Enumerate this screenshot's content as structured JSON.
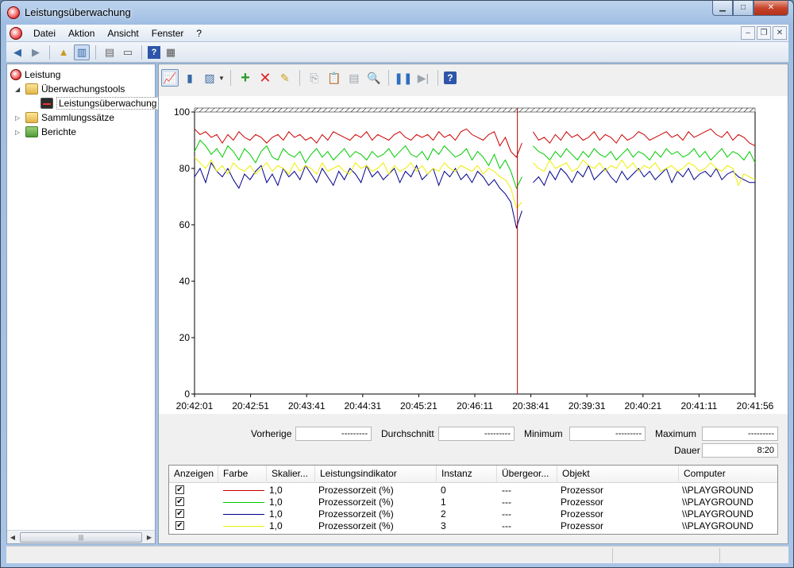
{
  "window": {
    "title": "Leistungsüberwachung"
  },
  "menu": [
    "Datei",
    "Aktion",
    "Ansicht",
    "Fenster",
    "?"
  ],
  "tree": {
    "root": "Leistung",
    "monitoring_tools": "Überwachungstools",
    "performance_monitor": "Leistungsüberwachung",
    "data_collector_sets": "Sammlungssätze",
    "reports": "Berichte"
  },
  "stats": {
    "previous_label": "Vorherige",
    "previous_value": "---------",
    "average_label": "Durchschnitt",
    "average_value": "---------",
    "minimum_label": "Minimum",
    "minimum_value": "---------",
    "maximum_label": "Maximum",
    "maximum_value": "---------",
    "duration_label": "Dauer",
    "duration_value": "8:20"
  },
  "legend_table": {
    "headers": [
      "Anzeigen",
      "Farbe",
      "Skalier...",
      "Leistungsindikator",
      "Instanz",
      "Übergeor...",
      "Objekt",
      "Computer"
    ],
    "rows": [
      {
        "show": "✔",
        "color": "#cc0000",
        "scale": "1,0",
        "counter": "Prozessorzeit (%)",
        "instance": "0",
        "parent": "---",
        "object": "Prozessor",
        "computer": "\\\\PLAYGROUND"
      },
      {
        "show": "✔",
        "color": "#00cc00",
        "scale": "1,0",
        "counter": "Prozessorzeit (%)",
        "instance": "1",
        "parent": "---",
        "object": "Prozessor",
        "computer": "\\\\PLAYGROUND"
      },
      {
        "show": "✔",
        "color": "#00008b",
        "scale": "1,0",
        "counter": "Prozessorzeit (%)",
        "instance": "2",
        "parent": "---",
        "object": "Prozessor",
        "computer": "\\\\PLAYGROUND"
      },
      {
        "show": "✔",
        "color": "#eeee00",
        "scale": "1,0",
        "counter": "Prozessorzeit (%)",
        "instance": "3",
        "parent": "---",
        "object": "Prozessor",
        "computer": "\\\\PLAYGROUND"
      }
    ]
  },
  "chart_data": {
    "type": "line",
    "title": "",
    "xlabel": "",
    "ylabel": "",
    "ylim": [
      0,
      100
    ],
    "yticks": [
      0,
      20,
      40,
      60,
      80,
      100
    ],
    "xticks": [
      "20:42:01",
      "20:42:51",
      "20:43:41",
      "20:44:31",
      "20:45:21",
      "20:46:11",
      "20:38:41",
      "20:39:31",
      "20:40:21",
      "20:41:11",
      "20:41:56"
    ],
    "grid": false,
    "cursor_position_fraction": 0.576,
    "series": [
      {
        "color": "#cc0000",
        "values": [
          94,
          92,
          93,
          91,
          92,
          89,
          92,
          90,
          93,
          91,
          90,
          92,
          91,
          89,
          91,
          92,
          90,
          93,
          91,
          92,
          90,
          91,
          89,
          92,
          90,
          93,
          92,
          91,
          90,
          92,
          91,
          93,
          90,
          92,
          91,
          90,
          92,
          93,
          91,
          90,
          92,
          91,
          92,
          90,
          93,
          91,
          92,
          90,
          93,
          94,
          92,
          91,
          90,
          92,
          93,
          88,
          91,
          86,
          84,
          89,
          null,
          93,
          90,
          91,
          89,
          92,
          90,
          93,
          91,
          92,
          90,
          91,
          93,
          90,
          92,
          91,
          89,
          92,
          90,
          91,
          93,
          92,
          90,
          91,
          92,
          93,
          91,
          92,
          90,
          93,
          91,
          92,
          93,
          94,
          92,
          91,
          93,
          90,
          92,
          91,
          89,
          88
        ]
      },
      {
        "color": "#00cc00",
        "values": [
          86,
          90,
          88,
          85,
          87,
          84,
          88,
          86,
          83,
          87,
          85,
          82,
          86,
          88,
          84,
          83,
          87,
          85,
          84,
          86,
          82,
          85,
          87,
          84,
          86,
          83,
          85,
          87,
          84,
          86,
          85,
          83,
          86,
          84,
          85,
          87,
          84,
          86,
          88,
          85,
          84,
          86,
          83,
          87,
          85,
          88,
          86,
          84,
          85,
          87,
          83,
          86,
          84,
          81,
          85,
          80,
          83,
          79,
          73,
          77,
          null,
          88,
          86,
          85,
          83,
          86,
          84,
          87,
          85,
          83,
          86,
          84,
          87,
          85,
          84,
          86,
          83,
          85,
          87,
          84,
          86,
          85,
          83,
          86,
          84,
          87,
          85,
          86,
          84,
          85,
          87,
          84,
          86,
          83,
          85,
          87,
          84,
          86,
          85,
          83,
          86,
          82
        ]
      },
      {
        "color": "#00008b",
        "values": [
          77,
          80,
          75,
          82,
          79,
          77,
          80,
          76,
          73,
          78,
          76,
          79,
          81,
          75,
          78,
          74,
          80,
          77,
          79,
          76,
          81,
          78,
          75,
          80,
          77,
          74,
          79,
          76,
          80,
          78,
          75,
          81,
          77,
          79,
          76,
          78,
          80,
          75,
          79,
          77,
          81,
          76,
          78,
          80,
          74,
          79,
          77,
          80,
          76,
          78,
          75,
          79,
          77,
          74,
          76,
          73,
          71,
          68,
          59,
          65,
          null,
          75,
          77,
          74,
          79,
          76,
          80,
          78,
          75,
          79,
          77,
          81,
          76,
          78,
          80,
          77,
          75,
          79,
          76,
          78,
          80,
          77,
          79,
          76,
          78,
          80,
          75,
          79,
          77,
          80,
          76,
          78,
          79,
          77,
          80,
          76,
          78,
          79,
          77,
          76,
          75,
          75
        ]
      },
      {
        "color": "#eeee00",
        "values": [
          84,
          82,
          80,
          83,
          79,
          81,
          78,
          82,
          80,
          79,
          81,
          78,
          80,
          82,
          79,
          81,
          80,
          78,
          82,
          79,
          81,
          80,
          78,
          82,
          79,
          80,
          81,
          79,
          78,
          82,
          80,
          81,
          79,
          80,
          82,
          78,
          81,
          79,
          80,
          82,
          79,
          81,
          78,
          80,
          79,
          82,
          80,
          79,
          81,
          80,
          79,
          81,
          78,
          80,
          79,
          77,
          76,
          73,
          66,
          68,
          null,
          82,
          80,
          79,
          83,
          80,
          81,
          82,
          79,
          80,
          83,
          81,
          80,
          82,
          79,
          81,
          80,
          83,
          80,
          82,
          79,
          81,
          80,
          82,
          79,
          80,
          81,
          79,
          80,
          82,
          81,
          79,
          80,
          82,
          80,
          79,
          81,
          80,
          74,
          78,
          77,
          76
        ]
      }
    ]
  }
}
